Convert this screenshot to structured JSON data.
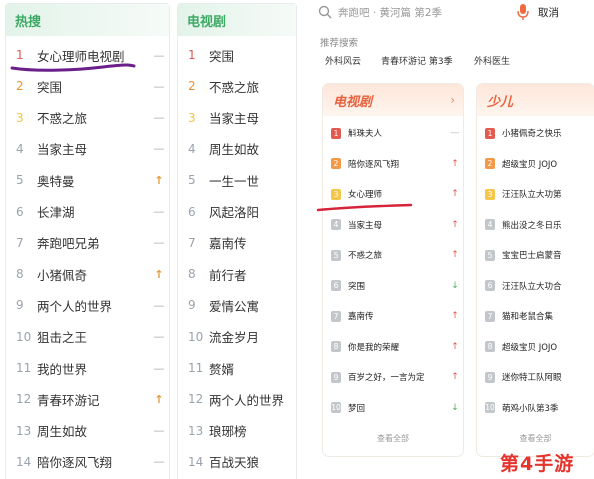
{
  "left_list": {
    "header": "热搜",
    "items": [
      {
        "rank": "1",
        "title": "女心理师电视剧",
        "trend": "—"
      },
      {
        "rank": "2",
        "title": "突围",
        "trend": "—"
      },
      {
        "rank": "3",
        "title": "不惑之旅",
        "trend": "—"
      },
      {
        "rank": "4",
        "title": "当家主母",
        "trend": "—"
      },
      {
        "rank": "5",
        "title": "奥特曼",
        "trend": "↑"
      },
      {
        "rank": "6",
        "title": "长津湖",
        "trend": "—"
      },
      {
        "rank": "7",
        "title": "奔跑吧兄弟",
        "trend": "—"
      },
      {
        "rank": "8",
        "title": "小猪佩奇",
        "trend": "↑"
      },
      {
        "rank": "9",
        "title": "两个人的世界",
        "trend": "—"
      },
      {
        "rank": "10",
        "title": "狙击之王",
        "trend": "—"
      },
      {
        "rank": "11",
        "title": "我的世界",
        "trend": "—"
      },
      {
        "rank": "12",
        "title": "青春环游记",
        "trend": "↑"
      },
      {
        "rank": "13",
        "title": "周生如故",
        "trend": "—"
      },
      {
        "rank": "14",
        "title": "陪你逐风飞翔",
        "trend": "—"
      }
    ]
  },
  "mid_list": {
    "header": "电视剧",
    "items": [
      {
        "rank": "1",
        "title": "突围"
      },
      {
        "rank": "2",
        "title": "不惑之旅"
      },
      {
        "rank": "3",
        "title": "当家主母"
      },
      {
        "rank": "4",
        "title": "周生如故"
      },
      {
        "rank": "5",
        "title": "一生一世"
      },
      {
        "rank": "6",
        "title": "风起洛阳"
      },
      {
        "rank": "7",
        "title": "嘉南传"
      },
      {
        "rank": "8",
        "title": "前行者"
      },
      {
        "rank": "9",
        "title": "爱情公寓"
      },
      {
        "rank": "10",
        "title": "流金岁月"
      },
      {
        "rank": "11",
        "title": "赘婿"
      },
      {
        "rank": "12",
        "title": "两个人的世界"
      },
      {
        "rank": "13",
        "title": "琅琊榜"
      },
      {
        "rank": "14",
        "title": "百战天狼"
      }
    ]
  },
  "search": {
    "placeholder": "奔跑吧 · 黄河篇 第2季",
    "cancel": "取消",
    "recommend_label": "推荐搜索",
    "chips": [
      "外科风云",
      "青春环游记 第3季",
      "外科医生"
    ]
  },
  "tv_card": {
    "title": "电视剧",
    "arrow": "›",
    "items": [
      {
        "rank": "1",
        "title": "斛珠夫人",
        "trend": "—"
      },
      {
        "rank": "2",
        "title": "陪你逐风飞翔",
        "trend": "↑"
      },
      {
        "rank": "3",
        "title": "女心理师",
        "trend": "↑"
      },
      {
        "rank": "4",
        "title": "当家主母",
        "trend": "↑"
      },
      {
        "rank": "5",
        "title": "不惑之旅",
        "trend": "↑"
      },
      {
        "rank": "6",
        "title": "突围",
        "trend": "↓"
      },
      {
        "rank": "7",
        "title": "嘉南传",
        "trend": "↑"
      },
      {
        "rank": "8",
        "title": "你是我的荣耀",
        "trend": "↑"
      },
      {
        "rank": "9",
        "title": "百岁之好，一言为定",
        "trend": "↑"
      },
      {
        "rank": "10",
        "title": "梦回",
        "trend": "↓"
      }
    ],
    "view_all": "查看全部"
  },
  "kids_card": {
    "title": "少儿",
    "items": [
      {
        "rank": "1",
        "title": "小猪佩奇之快乐"
      },
      {
        "rank": "2",
        "title": "超级宝贝 JOJO"
      },
      {
        "rank": "3",
        "title": "汪汪队立大功第"
      },
      {
        "rank": "4",
        "title": "熊出没之冬日乐"
      },
      {
        "rank": "5",
        "title": "宝宝巴士启蒙音"
      },
      {
        "rank": "6",
        "title": "汪汪队立大功合"
      },
      {
        "rank": "7",
        "title": "猫和老鼠合集"
      },
      {
        "rank": "8",
        "title": "超级宝贝 JOJO"
      },
      {
        "rank": "9",
        "title": "迷你特工队阿眼"
      },
      {
        "rank": "10",
        "title": "萌鸡小队第3季"
      }
    ],
    "view_all": "查看全部"
  },
  "watermark": "第4手游",
  "colors": {
    "green_header": "#3daa64",
    "orange_accent": "#e8623e",
    "purple_annotation": "#6a1f8a",
    "red_annotation": "#d6243a",
    "mic": "#ef6b3f"
  }
}
